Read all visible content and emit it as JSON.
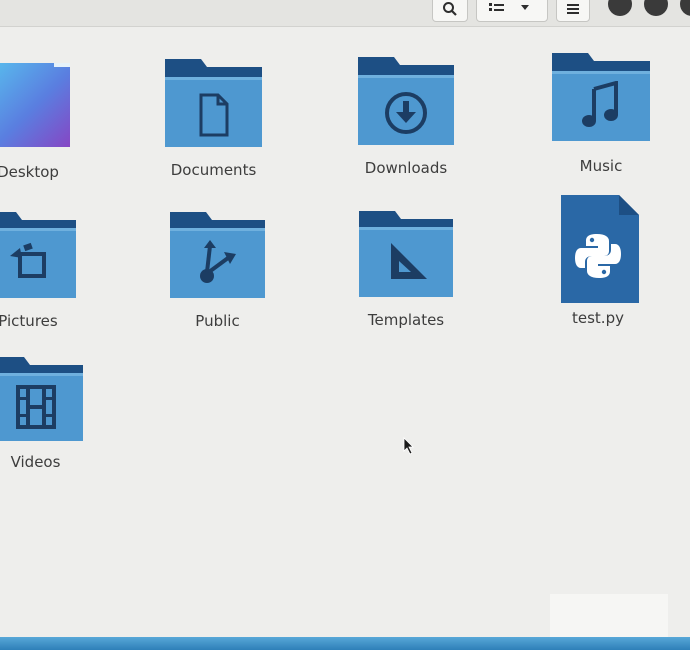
{
  "toolbar": {
    "search_icon": "search-icon",
    "view_options_icon": "view-options-icon",
    "menu_icon": "hamburger-menu-icon"
  },
  "items": [
    {
      "label": "Desktop",
      "icon": "desktop-wallpaper"
    },
    {
      "label": "Documents",
      "icon": "document-icon"
    },
    {
      "label": "Downloads",
      "icon": "download-icon"
    },
    {
      "label": "Music",
      "icon": "music-note-icon"
    },
    {
      "label": "Pictures",
      "icon": "pictures-icon"
    },
    {
      "label": "Public",
      "icon": "share-icon"
    },
    {
      "label": "Templates",
      "icon": "set-square-icon"
    },
    {
      "label": "test.py",
      "icon": "python-icon"
    },
    {
      "label": "Videos",
      "icon": "film-icon"
    }
  ],
  "colors": {
    "folder_front": "#4e98d0",
    "folder_back": "#1d4f84",
    "emblem": "#1c3d63",
    "background": "#eeeeec"
  }
}
